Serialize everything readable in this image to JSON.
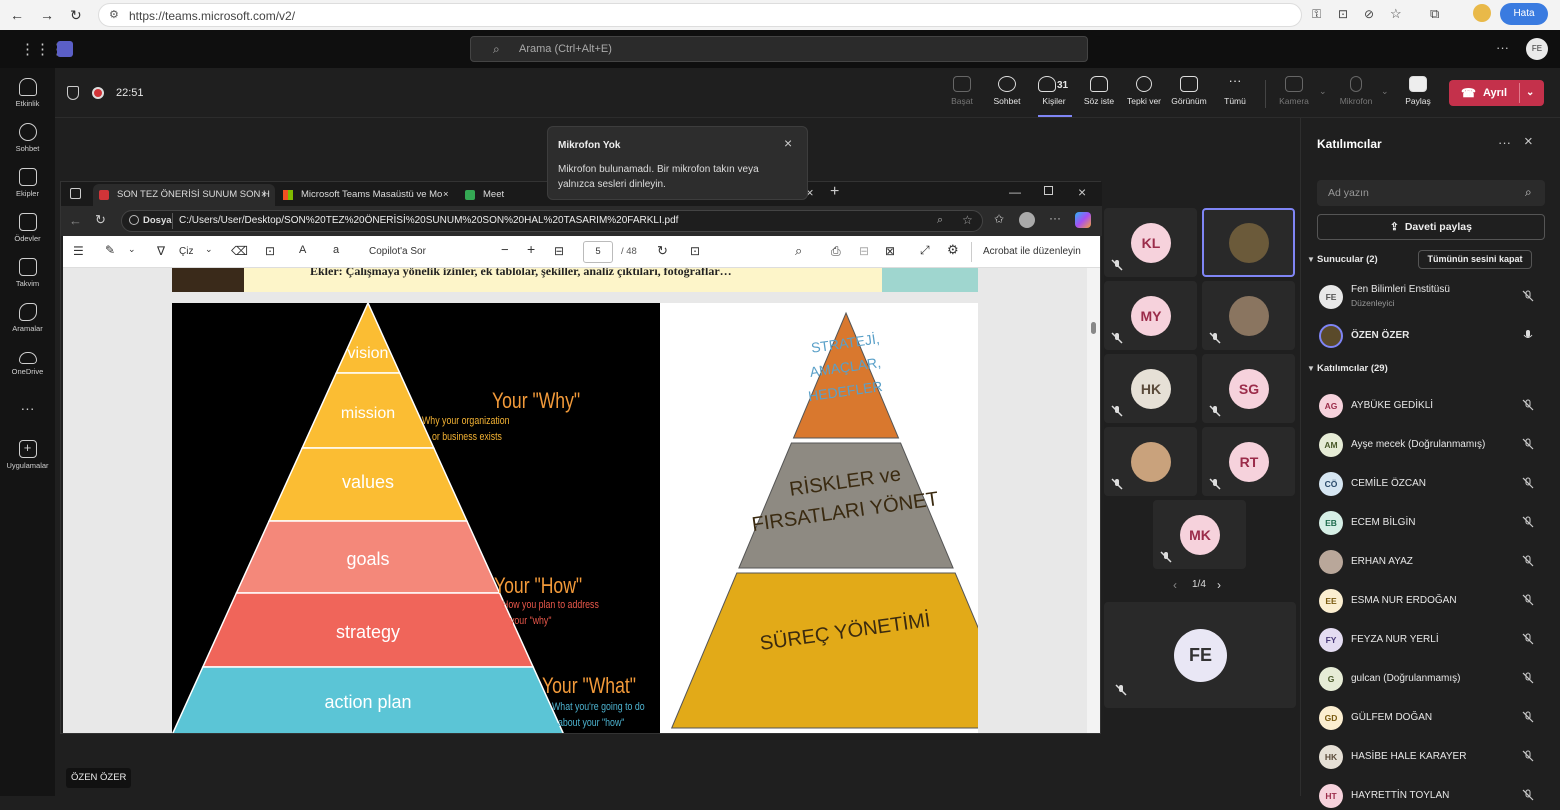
{
  "browser": {
    "url": "https://teams.microsoft.com/v2/",
    "profile_button": "Hata"
  },
  "header": {
    "search_placeholder": "Arama (Ctrl+Alt+E)",
    "user_initials": "FE"
  },
  "rail": [
    {
      "label": "Etkinlik",
      "icon": "bell-icon"
    },
    {
      "label": "Sohbet",
      "icon": "chat-icon"
    },
    {
      "label": "Ekipler",
      "icon": "teams-icon"
    },
    {
      "label": "Ödevler",
      "icon": "assignments-icon"
    },
    {
      "label": "Takvim",
      "icon": "calendar-icon"
    },
    {
      "label": "Aramalar",
      "icon": "phone-icon"
    },
    {
      "label": "OneDrive",
      "icon": "cloud-icon"
    },
    {
      "label": "Uygulamalar",
      "icon": "apps-icon"
    }
  ],
  "meeting": {
    "timer": "22:51",
    "toolbar": [
      {
        "label": "Başat",
        "icon": "start-icon",
        "dim": true
      },
      {
        "label": "Sohbet",
        "icon": "chat-icon"
      },
      {
        "label": "Kişiler",
        "icon": "people-icon",
        "count": "31"
      },
      {
        "label": "Söz iste",
        "icon": "raise-hand-icon"
      },
      {
        "label": "Tepki ver",
        "icon": "emoji-icon"
      },
      {
        "label": "Görünüm",
        "icon": "view-icon"
      },
      {
        "label": "Tümü",
        "icon": "more-icon"
      },
      {
        "label": "Kamera",
        "icon": "camera-off-icon",
        "dim": true
      },
      {
        "label": "Mikrofon",
        "icon": "mic-off-icon",
        "dim": true
      },
      {
        "label": "Paylaş",
        "icon": "share-icon"
      }
    ],
    "leave_label": "Ayrıl",
    "presenter_name": "ÖZEN ÖZER"
  },
  "toast": {
    "title": "Mikrofon Yok",
    "message": "Mikrofon bulunamadı. Bir mikrofon takın veya yalnızca sesleri dinleyin."
  },
  "shared": {
    "tabs": [
      "SON TEZ ÖNERİSİ SUNUM SON H",
      "Microsoft Teams Masaüstü ve Mo",
      "Meet"
    ],
    "address_prefix": "Dosya",
    "address": "C:/Users/User/Desktop/SON%20TEZ%20ÖNERİSİ%20SUNUM%20SON%20HAL%20TASARIM%20FARKLI.pdf",
    "pdf_toolbar": {
      "draw": "Çiz",
      "copilot": "Copilot'a Sor",
      "page": "5",
      "total": "/ 48",
      "acrobat": "Acrobat ile düzenleyin"
    },
    "doc_header": "Ekler: Çalışmaya yönelik izinler, ek tablolar, şekiller, analiz çıktıları, fotoğraflar…",
    "left_pyramid": {
      "levels": [
        "vision",
        "mission",
        "values",
        "goals",
        "strategy",
        "action plan"
      ],
      "colors": [
        "#fbbd33",
        "#fbbd33",
        "#fbbd33",
        "#f4887a",
        "#f0655a",
        "#5bc5d6"
      ],
      "callouts": [
        {
          "title": "Your \"Why\"",
          "sub1": "Why your organization",
          "sub2": "or business exists"
        },
        {
          "title": "Your \"How\"",
          "sub1": "How you plan to address",
          "sub2": "your \"why\""
        },
        {
          "title": "Your \"What\"",
          "sub1": "What you're going to do",
          "sub2": "about your \"how\""
        }
      ]
    },
    "right_pyramid": {
      "levels": [
        {
          "l1": "STRATEJİ,",
          "l2": "AMAÇLAR,",
          "l3": "HEDEFLER"
        },
        {
          "l1": "RİSKLER ve",
          "l2": "FIRSATLARI YÖNET",
          "l3": ""
        },
        {
          "l1": "SÜREÇ YÖNETİMİ",
          "l2": "",
          "l3": ""
        }
      ],
      "colors": [
        "#d9782e",
        "#8e8a82",
        "#e2aa18"
      ]
    }
  },
  "tiles": [
    {
      "initials": "KL",
      "bg": "#f6d2dc",
      "fg": "#9b2c4a"
    },
    {
      "initials": "",
      "photo": true
    },
    {
      "initials": "MY",
      "bg": "#f6d2dc",
      "fg": "#9b2c4a"
    },
    {
      "initials": "",
      "photo": true
    },
    {
      "initials": "HK",
      "bg": "#e6e0d6",
      "fg": "#5a4a3a"
    },
    {
      "initials": "SG",
      "bg": "#f6d2dc",
      "fg": "#9b2c4a"
    },
    {
      "initials": "",
      "photo": true
    },
    {
      "initials": "RT",
      "bg": "#f6d2dc",
      "fg": "#9b2c4a"
    },
    {
      "initials": "MK",
      "bg": "#f6d2dc",
      "fg": "#9b2c4a"
    }
  ],
  "tiles_pager": "1/4",
  "self_tile": {
    "initials": "FE"
  },
  "panel": {
    "title": "Katılımcılar",
    "search_placeholder": "Ad yazın",
    "invite": "Daveti paylaş",
    "presenters_label": "Sunucular (2)",
    "mute_all": "Tümünün sesini kapat",
    "presenters": [
      {
        "initials": "FE",
        "name": "Fen Bilimleri Enstitüsü",
        "role": "Düzenleyici",
        "bg": "#e8e8e8",
        "fg": "#555"
      },
      {
        "initials": "ÖÖ",
        "name": "ÖZEN ÖZER",
        "photo": true
      }
    ],
    "attendees_label": "Katılımcılar (29)",
    "attendees": [
      {
        "initials": "AG",
        "name": "AYBÜKE GEDİKLİ",
        "bg": "#f6d2dc",
        "fg": "#9b2c4a"
      },
      {
        "initials": "AM",
        "name": "Ayşe mecek (Doğrulanmamış)",
        "bg": "#e6ecd6",
        "fg": "#4a5a2a"
      },
      {
        "initials": "CÖ",
        "name": "CEMİLE ÖZCAN",
        "bg": "#d6e6f2",
        "fg": "#2a4a6a"
      },
      {
        "initials": "EB",
        "name": "ECEM BİLGİN",
        "bg": "#d6efe6",
        "fg": "#1f6b4d"
      },
      {
        "initials": "",
        "name": "ERHAN AYAZ",
        "photo": true
      },
      {
        "initials": "EE",
        "name": "ESMA NUR ERDOĞAN",
        "bg": "#fbeed0",
        "fg": "#7a5a10"
      },
      {
        "initials": "FY",
        "name": "FEYZA NUR YERLİ",
        "bg": "#e4dcf2",
        "fg": "#4a3a7a"
      },
      {
        "initials": "G",
        "name": "gulcan (Doğrulanmamış)",
        "bg": "#e6ecd6",
        "fg": "#4a5a2a"
      },
      {
        "initials": "GD",
        "name": "GÜLFEM DOĞAN",
        "bg": "#fbeed0",
        "fg": "#7a5a10"
      },
      {
        "initials": "HK",
        "name": "HASİBE HALE KARAYER",
        "bg": "#e6e0d6",
        "fg": "#5a4a3a"
      },
      {
        "initials": "HT",
        "name": "HAYRETTİN TOYLAN",
        "bg": "#f6d2dc",
        "fg": "#9b2c4a"
      }
    ]
  }
}
